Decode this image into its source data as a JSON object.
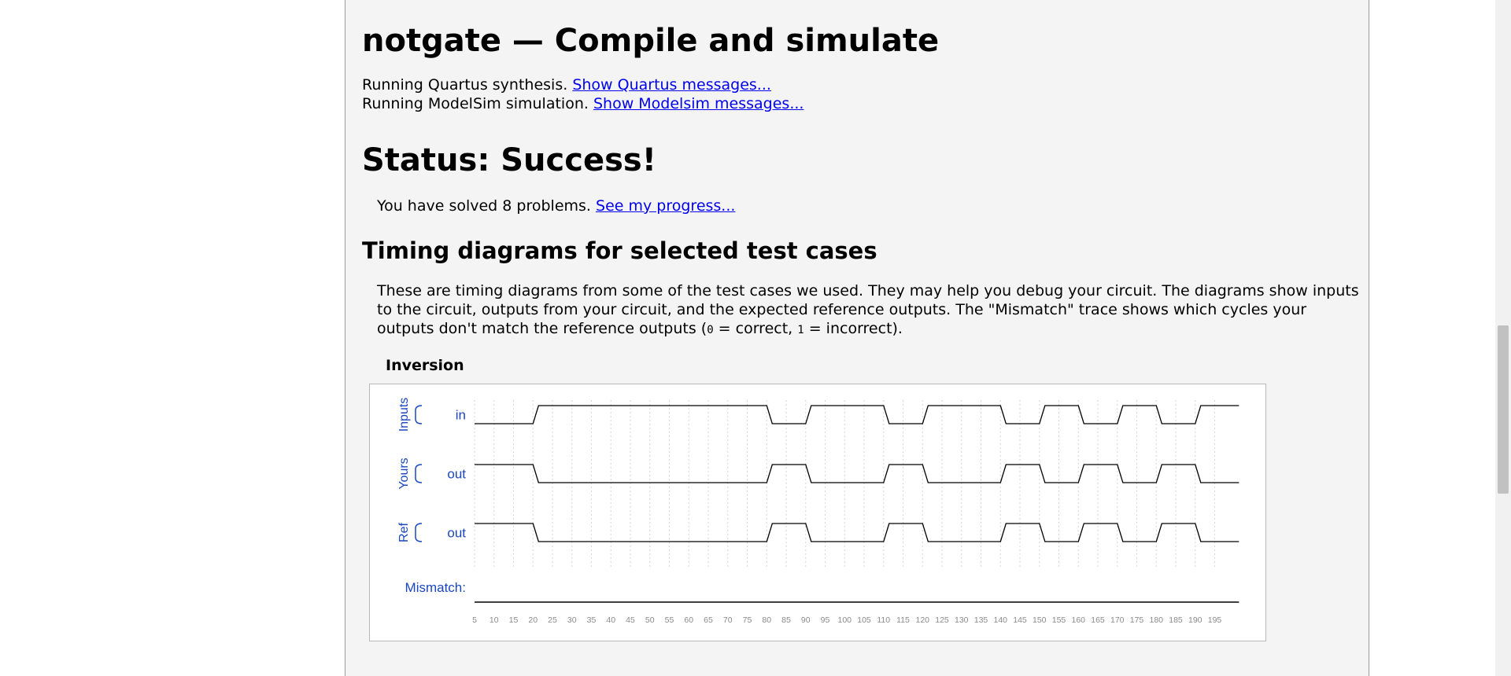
{
  "compile": {
    "title": "notgate — Compile and simulate",
    "quartus_text": "Running Quartus synthesis.",
    "quartus_link": "Show Quartus messages...",
    "modelsim_text": "Running ModelSim simulation.",
    "modelsim_link": "Show Modelsim messages..."
  },
  "status": {
    "title": "Status: Success!",
    "solved_text": "You have solved 8 problems.",
    "progress_link": "See my progress..."
  },
  "timing": {
    "heading": "Timing diagrams for selected test cases",
    "desc_1": "These are timing diagrams from some of the test cases we used. They may help you debug your circuit. The diagrams show inputs to the circuit, outputs from your circuit, and the expected reference outputs. The \"Mismatch\" trace shows which cycles your outputs don't match the reference outputs (",
    "code_0": "0",
    "desc_2": " = correct, ",
    "code_1": "1",
    "desc_3": " = incorrect).",
    "testcase_title": "Inversion"
  },
  "chart_data": {
    "type": "timing",
    "groups": [
      "Inputs",
      "Yours",
      "Ref"
    ],
    "signals": [
      {
        "group": "Inputs",
        "name": "in",
        "transitions": [
          [
            0,
            0
          ],
          [
            20,
            1
          ],
          [
            80,
            0
          ],
          [
            90,
            1
          ],
          [
            110,
            0
          ],
          [
            120,
            1
          ],
          [
            140,
            0
          ],
          [
            150,
            1
          ],
          [
            160,
            0
          ],
          [
            170,
            1
          ],
          [
            180,
            0
          ],
          [
            190,
            1
          ]
        ]
      },
      {
        "group": "Yours",
        "name": "out",
        "transitions": [
          [
            0,
            1
          ],
          [
            20,
            0
          ],
          [
            80,
            1
          ],
          [
            90,
            0
          ],
          [
            110,
            1
          ],
          [
            120,
            0
          ],
          [
            140,
            1
          ],
          [
            150,
            0
          ],
          [
            160,
            1
          ],
          [
            170,
            0
          ],
          [
            180,
            1
          ],
          [
            190,
            0
          ]
        ]
      },
      {
        "group": "Ref",
        "name": "out",
        "transitions": [
          [
            0,
            1
          ],
          [
            20,
            0
          ],
          [
            80,
            1
          ],
          [
            90,
            0
          ],
          [
            110,
            1
          ],
          [
            120,
            0
          ],
          [
            140,
            1
          ],
          [
            150,
            0
          ],
          [
            160,
            1
          ],
          [
            170,
            0
          ],
          [
            180,
            1
          ],
          [
            190,
            0
          ]
        ]
      }
    ],
    "mismatch": {
      "name": "Mismatch:",
      "transitions": [
        [
          0,
          0
        ]
      ]
    },
    "xlim": [
      5,
      200
    ],
    "xticks": [
      5,
      10,
      15,
      20,
      25,
      30,
      35,
      40,
      45,
      50,
      55,
      60,
      65,
      70,
      75,
      80,
      85,
      90,
      95,
      100,
      105,
      110,
      115,
      120,
      125,
      130,
      135,
      140,
      145,
      150,
      155,
      160,
      165,
      170,
      175,
      180,
      185,
      190,
      195
    ],
    "grid": true,
    "colors": {
      "trace": "#000000",
      "label": "#1a47c0",
      "tick": "#8a8a8a",
      "grid": "#d6d6d6"
    }
  }
}
